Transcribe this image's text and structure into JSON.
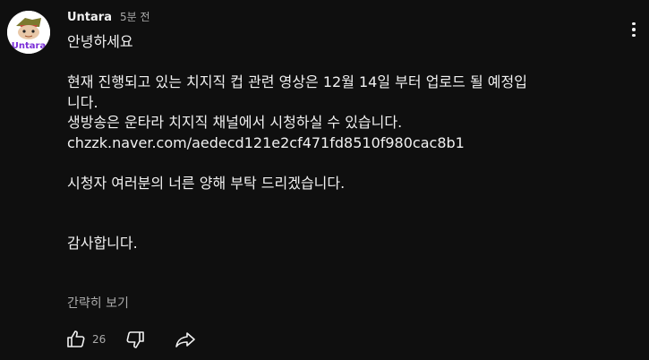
{
  "comment": {
    "author": "Untara",
    "avatar_text": "Untara",
    "time": "5분 전",
    "lines": [
      "안녕하세요",
      "",
      "현재 진행되고 있는 치지직 컵 관련 영상은 12월 14일 부터 업로드 될 예정입",
      "니다.",
      "생방송은 운타라 치지직 채널에서 시청하실 수 있습니다.",
      "chzzk.naver.com/aedecd121e2cf471fd8510f980cac8b1",
      "",
      "시청자 여러분의 너른 양해 부탁 드리겠습니다.",
      "",
      "",
      "감사합니다."
    ],
    "read_more": "간략히 보기",
    "like_count": "26"
  },
  "colors": {
    "background": "#0f0f0f",
    "text": "#f1f1f1",
    "muted": "#aaaaaa",
    "avatar_text": "#7b2fd8"
  }
}
